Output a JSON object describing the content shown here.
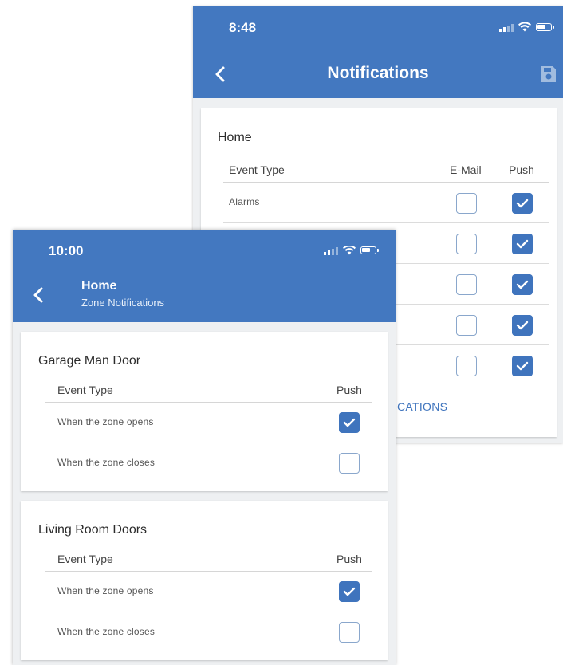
{
  "back_screen": {
    "status_time": "8:48",
    "title": "Notifications",
    "section_title": "Home",
    "columns": {
      "event_type": "Event Type",
      "email": "E-Mail",
      "push": "Push"
    },
    "rows": [
      {
        "label": "Alarms",
        "email": false,
        "push": true
      },
      {
        "label": "",
        "email": false,
        "push": true
      },
      {
        "label": "",
        "email": false,
        "push": true
      },
      {
        "label": "",
        "email": false,
        "push": true
      },
      {
        "label": "",
        "email": false,
        "push": true
      }
    ],
    "link_text": "CATIONS"
  },
  "front_screen": {
    "status_time": "10:00",
    "title": "Home",
    "subtitle": "Zone Notifications",
    "zones": [
      {
        "name": "Garage Man Door",
        "columns": {
          "event_type": "Event Type",
          "push": "Push"
        },
        "rows": [
          {
            "label": "When the zone opens",
            "push": true
          },
          {
            "label": "When the zone closes",
            "push": false
          }
        ]
      },
      {
        "name": "Living Room Doors",
        "columns": {
          "event_type": "Event Type",
          "push": "Push"
        },
        "rows": [
          {
            "label": "When the zone opens",
            "push": true
          },
          {
            "label": "When the zone closes",
            "push": false
          }
        ]
      }
    ]
  },
  "icons": {
    "back": "chevron-left-icon",
    "save": "save-icon",
    "checkbox_checked": "check-icon",
    "signal": "signal-icon",
    "wifi": "wifi-icon",
    "battery": "battery-icon"
  },
  "colors": {
    "app_bar": "#4378c0",
    "accent": "#3f74bd",
    "background": "#eef0f2"
  }
}
